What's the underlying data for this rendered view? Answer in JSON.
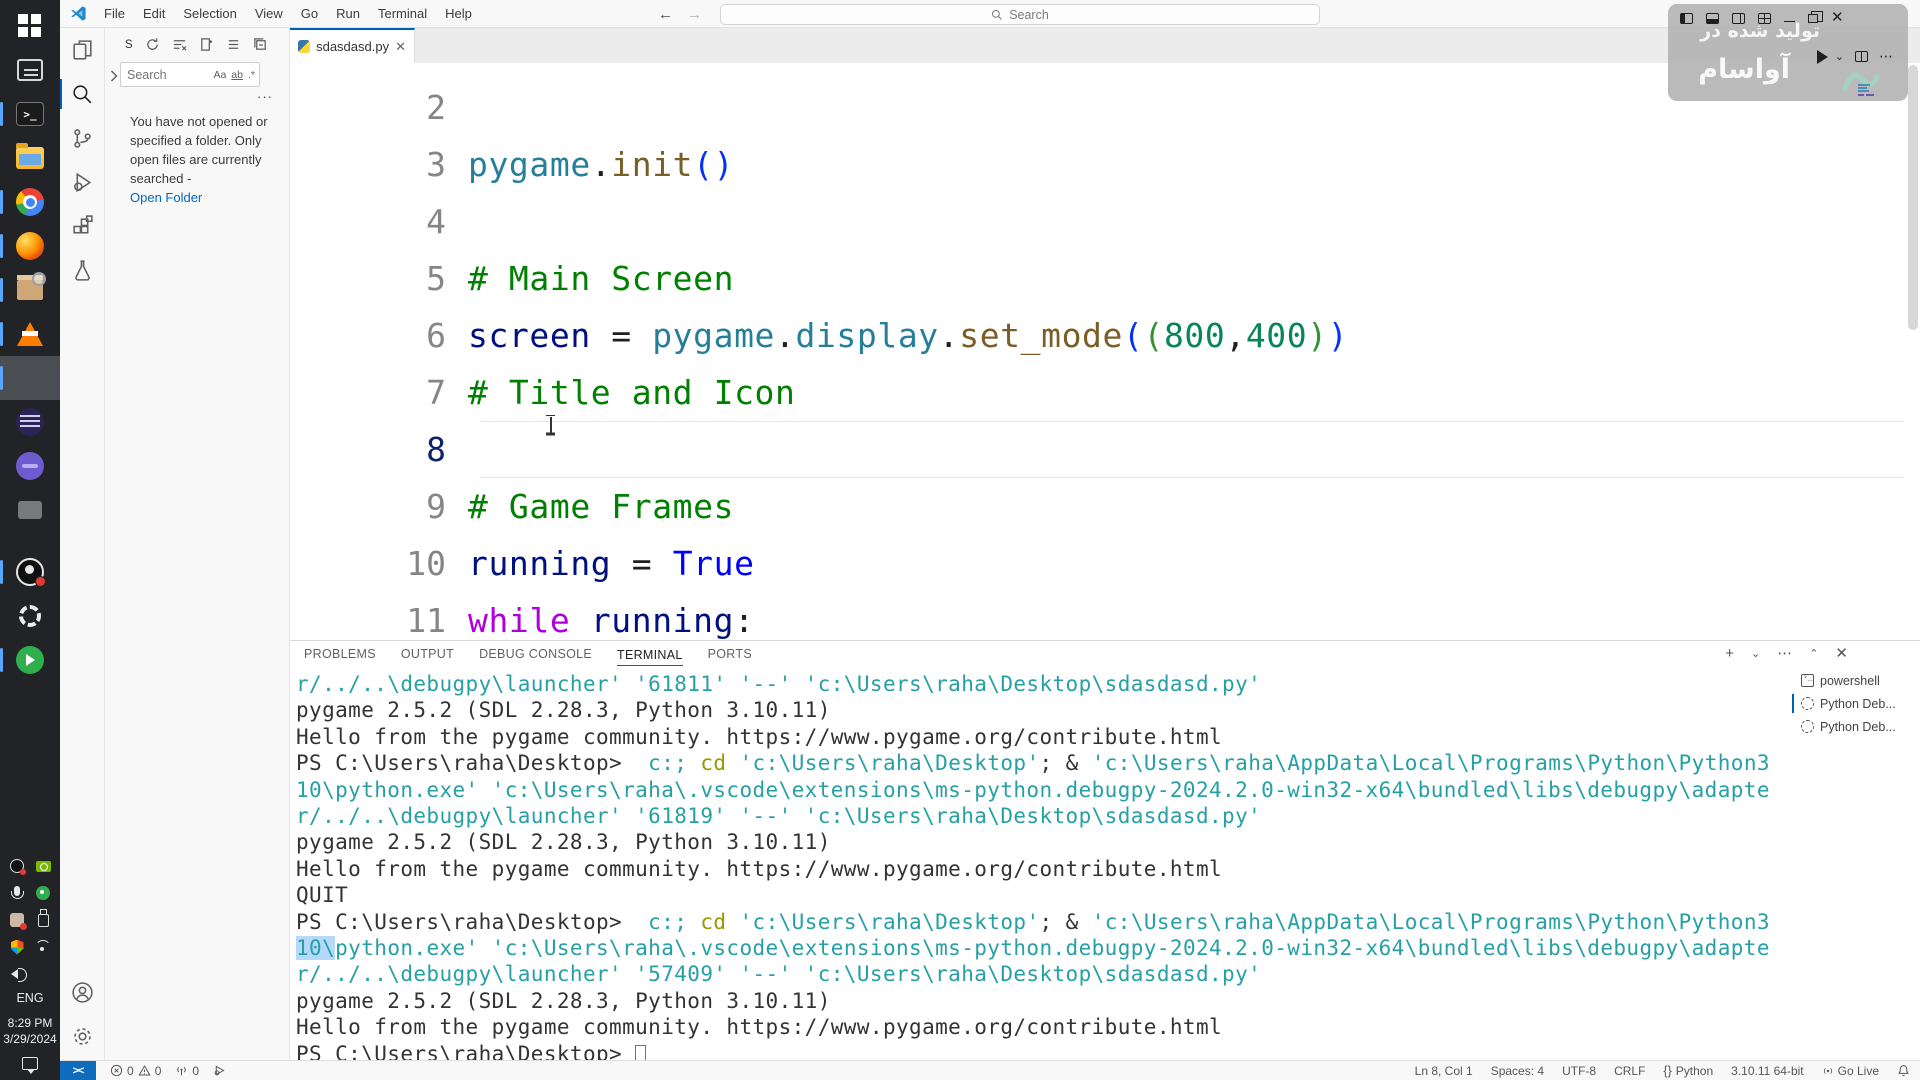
{
  "taskbar": {
    "pinned": [
      {
        "id": "start",
        "accent": false,
        "active": false
      },
      {
        "id": "task-view",
        "accent": false,
        "active": false
      },
      {
        "id": "terminal",
        "accent": true,
        "active": false
      },
      {
        "id": "file-explorer",
        "accent": false,
        "active": false
      },
      {
        "id": "chrome",
        "accent": true,
        "active": false
      },
      {
        "id": "firefox",
        "accent": true,
        "active": false
      },
      {
        "id": "package-app",
        "accent": true,
        "active": false
      },
      {
        "id": "vlc",
        "accent": true,
        "active": false
      },
      {
        "id": "vscode",
        "accent": true,
        "active": true
      },
      {
        "id": "eclipse",
        "accent": false,
        "active": false
      },
      {
        "id": "purple-app",
        "accent": false,
        "active": false
      },
      {
        "id": "misc-app",
        "accent": false,
        "active": false
      }
    ],
    "mid": [
      {
        "id": "obs",
        "accent": true,
        "active": false
      },
      {
        "id": "settings",
        "accent": false,
        "active": false
      },
      {
        "id": "green-app",
        "accent": true,
        "active": false
      }
    ],
    "tray": [
      "obs-tray",
      "nvidia",
      "mic",
      "green-tray",
      "user",
      "usb",
      "security",
      "wifi",
      "volume"
    ],
    "language": "ENG",
    "time": "8:29 PM",
    "date": "3/29/2024"
  },
  "titlebar": {
    "menus": [
      "File",
      "Edit",
      "Selection",
      "View",
      "Go",
      "Run",
      "Terminal",
      "Help"
    ],
    "search_placeholder": "Search"
  },
  "watermark": {
    "line1": "تولید شده در",
    "line2": "آواسام"
  },
  "sidebar": {
    "title_letter": "S",
    "search_placeholder": "Search",
    "match_case": "Aa",
    "whole_word": "ab",
    "regex": ".*",
    "more": "···",
    "message": "You have not opened or specified a folder. Only open files are currently searched -",
    "link": "Open Folder"
  },
  "editor": {
    "tab_label": "sdasdasd.py",
    "lines": [
      {
        "n": "2",
        "t": []
      },
      {
        "n": "3",
        "t": [
          [
            "pygame",
            "mod"
          ],
          [
            ".",
            "op"
          ],
          [
            "init",
            "fn"
          ],
          [
            "(",
            "b1"
          ],
          [
            ")",
            "b1"
          ]
        ]
      },
      {
        "n": "4",
        "t": []
      },
      {
        "n": "5",
        "t": [
          [
            "# Main Screen",
            "com"
          ]
        ]
      },
      {
        "n": "6",
        "t": [
          [
            "screen",
            "var"
          ],
          [
            " ",
            "op"
          ],
          [
            "=",
            "op"
          ],
          [
            " ",
            "op"
          ],
          [
            "pygame",
            "mod"
          ],
          [
            ".",
            "op"
          ],
          [
            "display",
            "mod"
          ],
          [
            ".",
            "op"
          ],
          [
            "set_mode",
            "fn"
          ],
          [
            "(",
            "b1"
          ],
          [
            "(",
            "b2"
          ],
          [
            "800",
            "num"
          ],
          [
            ",",
            "op"
          ],
          [
            "400",
            "num"
          ],
          [
            ")",
            "b2"
          ],
          [
            ")",
            "b1"
          ]
        ]
      },
      {
        "n": "7",
        "t": [
          [
            "# Title and Icon",
            "com"
          ]
        ]
      },
      {
        "n": "8",
        "t": [],
        "active": true
      },
      {
        "n": "9",
        "t": [
          [
            "# Game Frames",
            "com"
          ]
        ]
      },
      {
        "n": "10",
        "t": [
          [
            "running",
            "var"
          ],
          [
            " ",
            "op"
          ],
          [
            "=",
            "op"
          ],
          [
            " ",
            "op"
          ],
          [
            "True",
            "kw"
          ]
        ]
      },
      {
        "n": "11",
        "t": [
          [
            "while",
            "ctrl"
          ],
          [
            " ",
            "op"
          ],
          [
            "running",
            "var"
          ],
          [
            ":",
            "op"
          ]
        ]
      }
    ]
  },
  "panel": {
    "tabs": [
      "PROBLEMS",
      "OUTPUT",
      "DEBUG CONSOLE",
      "TERMINAL",
      "PORTS"
    ],
    "active_tab": "TERMINAL",
    "sessions": [
      {
        "type": "term",
        "label": "powershell",
        "selected": false
      },
      {
        "type": "debug",
        "label": "Python Deb...",
        "selected": true
      },
      {
        "type": "debug",
        "label": "Python Deb...",
        "selected": false
      }
    ]
  },
  "terminal_lines": [
    [
      [
        "r/../..\\debugpy\\launcher' '61811' '--' 'c:\\Users\\raha\\Desktop\\sdasdasd.py'",
        "str"
      ]
    ],
    [
      [
        "pygame 2.5.2 (SDL 2.28.3, Python 3.10.11)",
        "fg"
      ]
    ],
    [
      [
        "Hello from the pygame community. https://www.pygame.org/contribute.html",
        "fg"
      ]
    ],
    [
      [
        "PS C:\\Users\\raha\\Desktop> ",
        "fg"
      ],
      [
        " ",
        "fg"
      ],
      [
        "c:;",
        "str"
      ],
      [
        " ",
        "fg"
      ],
      [
        "cd",
        "cmd"
      ],
      [
        " ",
        "fg"
      ],
      [
        "'c:\\Users\\raha\\Desktop'",
        "str"
      ],
      [
        "; & ",
        "fg"
      ],
      [
        "'c:\\Users\\raha\\AppData\\Local\\Programs\\Python\\Python3",
        "str"
      ]
    ],
    [
      [
        "10\\python.exe' 'c:\\Users\\raha\\.vscode\\extensions\\ms-python.debugpy-2024.2.0-win32-x64\\bundled\\libs\\debugpy\\adapte",
        "str"
      ]
    ],
    [
      [
        "r/../..\\debugpy\\launcher' '61819' '--' 'c:\\Users\\raha\\Desktop\\sdasdasd.py'",
        "str"
      ]
    ],
    [
      [
        "pygame 2.5.2 (SDL 2.28.3, Python 3.10.11)",
        "fg"
      ]
    ],
    [
      [
        "Hello from the pygame community. https://www.pygame.org/contribute.html",
        "fg"
      ]
    ],
    [
      [
        "QUIT",
        "fg"
      ]
    ],
    [
      [
        "PS C:\\Users\\raha\\Desktop> ",
        "fg"
      ],
      [
        " ",
        "fg"
      ],
      [
        "c:;",
        "str"
      ],
      [
        " ",
        "fg"
      ],
      [
        "cd",
        "cmd"
      ],
      [
        " ",
        "fg"
      ],
      [
        "'c:\\Users\\raha\\Desktop'",
        "str"
      ],
      [
        "; & ",
        "fg"
      ],
      [
        "'c:\\Users\\raha\\AppData\\Local\\Programs\\Python\\Python3",
        "str"
      ]
    ],
    [
      [
        "10\\",
        "strsel"
      ],
      [
        "python.exe' 'c:\\Users\\raha\\.vscode\\extensions\\ms-python.debugpy-2024.2.0-win32-x64\\bundled\\libs\\debugpy\\adapte",
        "str"
      ]
    ],
    [
      [
        "r/../..\\debugpy\\launcher' '57409' '--' 'c:\\Users\\raha\\Desktop\\sdasdasd.py'",
        "str"
      ]
    ],
    [
      [
        "pygame 2.5.2 (SDL 2.28.3, Python 3.10.11)",
        "fg"
      ]
    ],
    [
      [
        "Hello from the pygame community. https://www.pygame.org/contribute.html",
        "fg"
      ]
    ],
    [
      [
        "PS C:\\Users\\raha\\Desktop> ",
        "fg"
      ],
      [
        "",
        "cursor"
      ]
    ]
  ],
  "statusbar": {
    "errors": "0",
    "warnings": "0",
    "ports": "0",
    "ln_col": "Ln 8, Col 1",
    "indent": "Spaces: 4",
    "encoding": "UTF-8",
    "eol": "CRLF",
    "lang_icon": "{}",
    "language": "Python",
    "interpreter": "3.10.11 64-bit",
    "golive": "Go Live"
  },
  "colors": {
    "accent_blue": "#005fb8",
    "remote_chip": "#0f6cbd",
    "terminal_teal": "#26a0a5",
    "terminal_cmd": "#999800",
    "comment_green": "#008000"
  }
}
